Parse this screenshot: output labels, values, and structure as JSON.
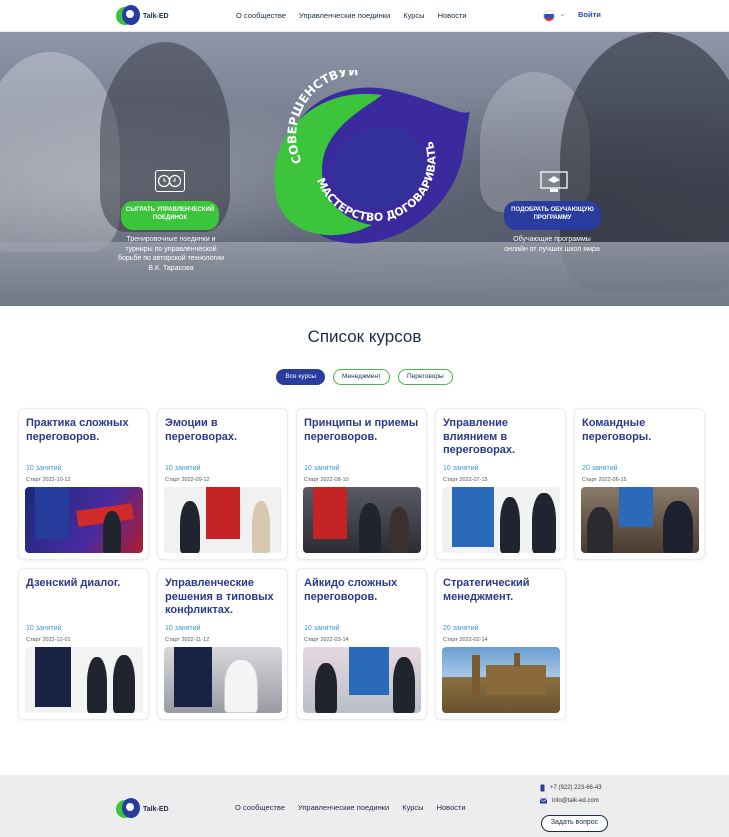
{
  "brand": {
    "name": "Talk-ED"
  },
  "header": {
    "nav": [
      "О сообществе",
      "Управленческие поединки",
      "Курсы",
      "Новости"
    ],
    "login": "Войти"
  },
  "hero": {
    "logo_text_top": "СОВЕРШЕНСТВУЙ",
    "logo_text_bottom": "МАСТЕРСТВО ДОГОВАРИВАТЬСЯ",
    "left": {
      "button": "СЫГРАТЬ УПРАВЛЕНЧЕСКИЙ ПОЕДИНОК",
      "description": "Тренировочные поединки и турниры по управленческой борьбе по авторской технологии В.К. Тарасова"
    },
    "right": {
      "button": "ПОДОБРАТЬ ОБУЧАЮЩУЮ ПРОГРАММУ",
      "description": "Обучающие программы онлайн от лучших школ мира"
    }
  },
  "courses": {
    "title": "Список курсов",
    "filters": [
      "Все курсы",
      "Менеджмент",
      "Переговоры"
    ],
    "items": [
      {
        "title": "Практика сложных переговоров.",
        "lessons": "10 занятий",
        "start": "Старт 2022-10-12"
      },
      {
        "title": "Эмоции в переговорах.",
        "lessons": "10 занятий",
        "start": "Старт 2022-09-12"
      },
      {
        "title": "Принципы и приемы переговоров.",
        "lessons": "10 занятий",
        "start": "Старт 2022-08-10"
      },
      {
        "title": "Управление влиянием в переговорах.",
        "lessons": "10 занятий",
        "start": "Старт 2022-07-15"
      },
      {
        "title": "Командные переговоры.",
        "lessons": "20 занятий",
        "start": "Старт 2022-06-15"
      },
      {
        "title": "Дзенский диалог.",
        "lessons": "10 занятий",
        "start": "Старт 2022-12-01"
      },
      {
        "title": "Управленческие решения в типовых конфликтах.",
        "lessons": "10 занятий",
        "start": "Старт 2022-11-12"
      },
      {
        "title": "Айкидо сложных переговоров.",
        "lessons": "10 занятий",
        "start": "Старт 2022-03-14"
      },
      {
        "title": "Стратегический менеджмент.",
        "lessons": "20 занятий",
        "start": "Старт 2022-02-14"
      }
    ]
  },
  "footer": {
    "nav": [
      "О сообществе",
      "Управленческие поединки",
      "Курсы",
      "Новости"
    ],
    "phone": "+7 (922) 223-66-43",
    "email": "info@talk-ed.com",
    "ask_button": "Задать вопрос"
  },
  "colors": {
    "brand_blue": "#2a3c9e",
    "brand_green": "#3cc43c",
    "title_blue": "#2a3a8c",
    "lessons_blue": "#3a9ad6"
  }
}
